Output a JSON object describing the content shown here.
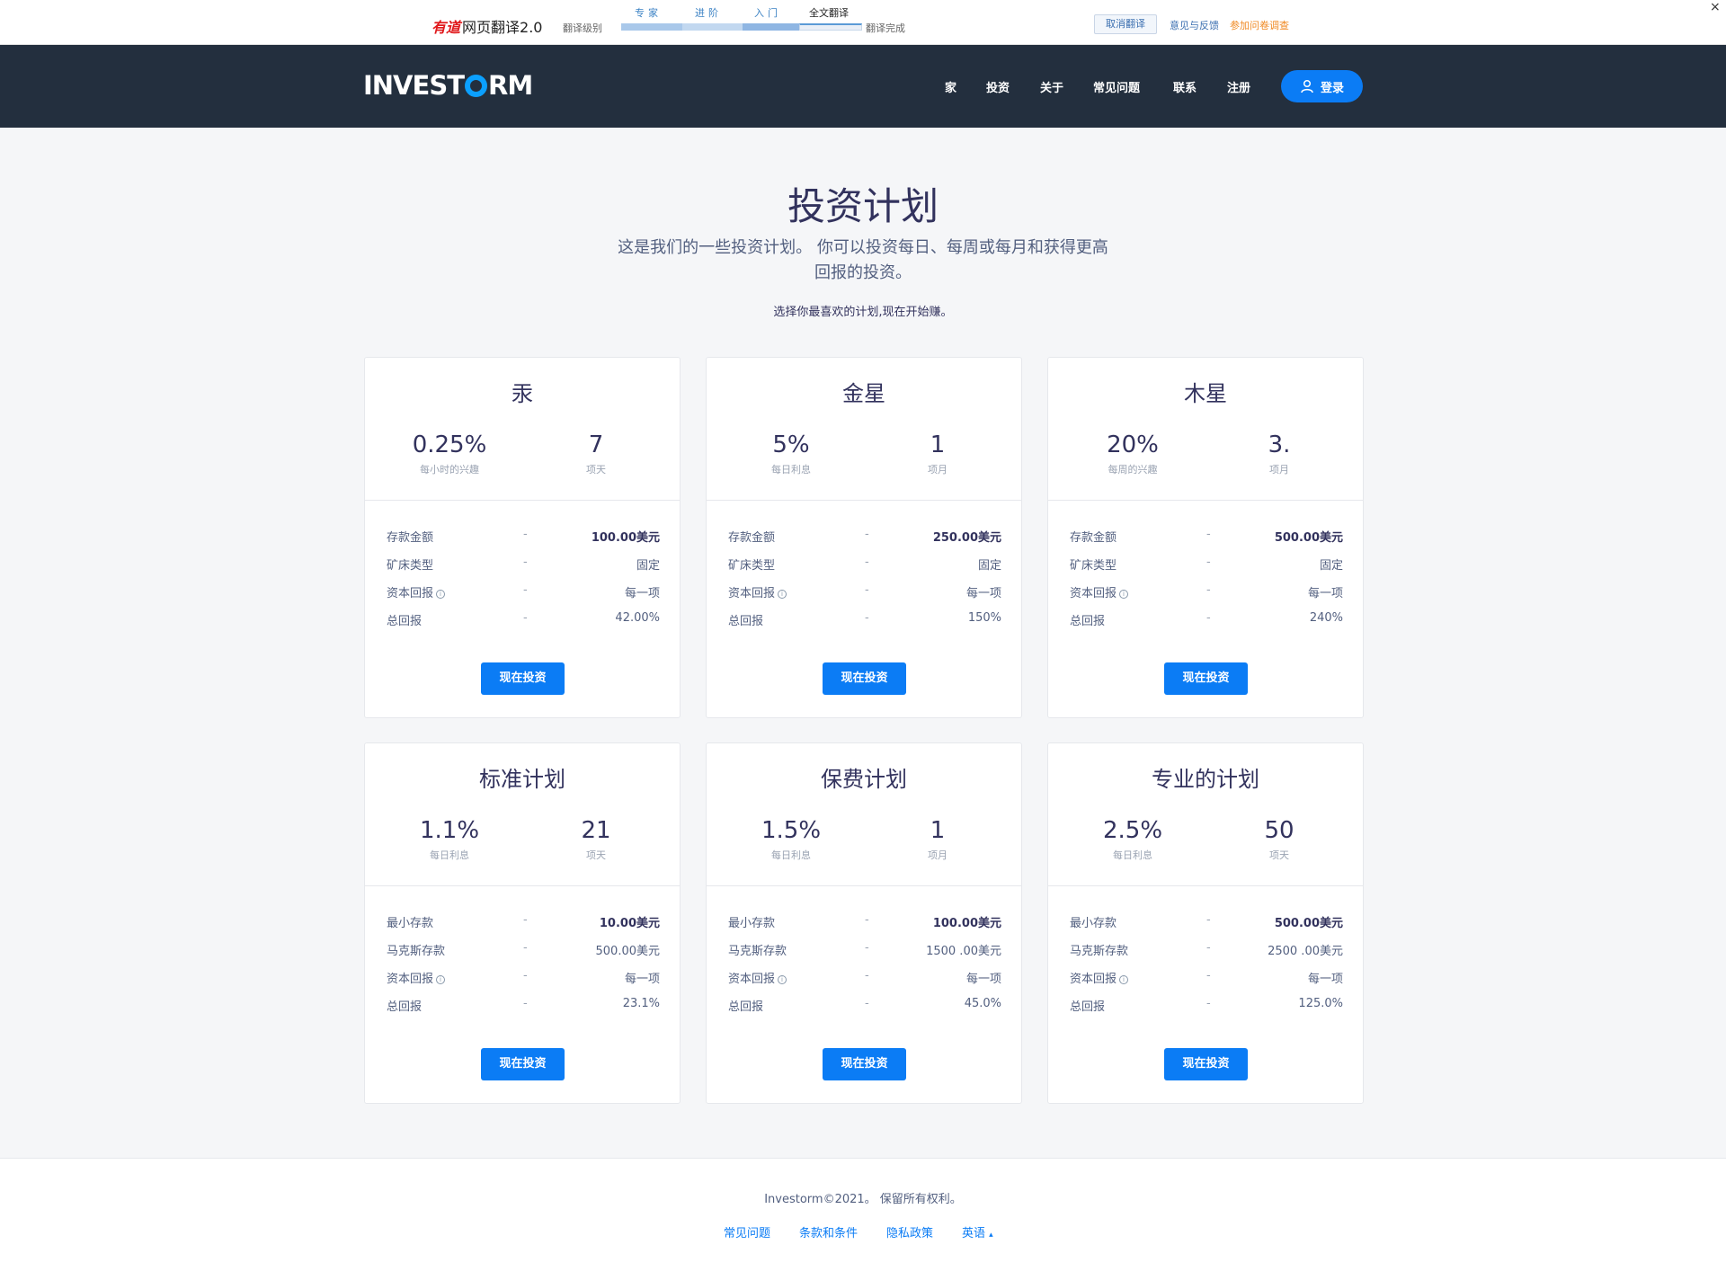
{
  "youdao": {
    "brand": "有道",
    "product": "网页翻译2.0",
    "level_label": "翻译级别",
    "levels": [
      "专家",
      "进阶",
      "入门",
      "全文翻译"
    ],
    "done": "翻译完成",
    "cancel": "取消翻译",
    "feedback": "意见与反馈",
    "survey": "参加问卷调查",
    "close": "×"
  },
  "nav": {
    "logo_left": "INVEST",
    "logo_right": "RM",
    "items": [
      "家",
      "投资",
      "关于",
      "常见问题",
      "联系",
      "注册"
    ],
    "login": "登录"
  },
  "hero": {
    "title": "投资计划",
    "subtitle": "这是我们的一些投资计划。 你可以投资每日、每周或每月和获得更高回报的投资。",
    "note": "选择你最喜欢的计划,现在开始赚。"
  },
  "plans": [
    {
      "name": "汞",
      "rate": "0.25%",
      "rate_label": "每小时的兴趣",
      "term": "7",
      "term_label": "项天",
      "rows": [
        {
          "k": "存款金额",
          "v": "100.00美元",
          "bold": true
        },
        {
          "k": "矿床类型",
          "v": "固定"
        },
        {
          "k": "资本回报",
          "v": "每一项",
          "info": true
        },
        {
          "k": "总回报",
          "v": "42.00%"
        }
      ],
      "button": "现在投资"
    },
    {
      "name": "金星",
      "rate": "5%",
      "rate_label": "每日利息",
      "term": "1",
      "term_label": "项月",
      "rows": [
        {
          "k": "存款金额",
          "v": "250.00美元",
          "bold": true
        },
        {
          "k": "矿床类型",
          "v": "固定"
        },
        {
          "k": "资本回报",
          "v": "每一项",
          "info": true
        },
        {
          "k": "总回报",
          "v": "150%"
        }
      ],
      "button": "现在投资"
    },
    {
      "name": "木星",
      "rate": "20%",
      "rate_label": "每周的兴趣",
      "term": "3.",
      "term_label": "项月",
      "rows": [
        {
          "k": "存款金额",
          "v": "500.00美元",
          "bold": true
        },
        {
          "k": "矿床类型",
          "v": "固定"
        },
        {
          "k": "资本回报",
          "v": "每一项",
          "info": true
        },
        {
          "k": "总回报",
          "v": "240%"
        }
      ],
      "button": "现在投资"
    },
    {
      "name": "标准计划",
      "rate": "1.1%",
      "rate_label": "每日利息",
      "term": "21",
      "term_label": "项天",
      "rows": [
        {
          "k": "最小存款",
          "v": "10.00美元",
          "bold": true
        },
        {
          "k": "马克斯存款",
          "v": "500.00美元"
        },
        {
          "k": "资本回报",
          "v": "每一项",
          "info": true
        },
        {
          "k": "总回报",
          "v": "23.1%"
        }
      ],
      "button": "现在投资"
    },
    {
      "name": "保费计划",
      "rate": "1.5%",
      "rate_label": "每日利息",
      "term": "1",
      "term_label": "项月",
      "rows": [
        {
          "k": "最小存款",
          "v": "100.00美元",
          "bold": true
        },
        {
          "k": "马克斯存款",
          "v": "1500 .00美元"
        },
        {
          "k": "资本回报",
          "v": "每一项",
          "info": true
        },
        {
          "k": "总回报",
          "v": "45.0%"
        }
      ],
      "button": "现在投资"
    },
    {
      "name": "专业的计划",
      "rate": "2.5%",
      "rate_label": "每日利息",
      "term": "50",
      "term_label": "项天",
      "rows": [
        {
          "k": "最小存款",
          "v": "500.00美元",
          "bold": true
        },
        {
          "k": "马克斯存款",
          "v": "2500 .00美元"
        },
        {
          "k": "资本回报",
          "v": "每一项",
          "info": true
        },
        {
          "k": "总回报",
          "v": "125.0%"
        }
      ],
      "button": "现在投资"
    }
  ],
  "dash": "-",
  "footer": {
    "copyright": "Investorm©2021。 保留所有权利。",
    "links": [
      "常见问题",
      "条款和条件",
      "隐私政策",
      "英语"
    ]
  },
  "colors": {
    "navbar": "#232f3e",
    "accent": "#0b7cf5",
    "logo_o": "#0ba0ff",
    "youdao_brand": "#e0191c"
  }
}
